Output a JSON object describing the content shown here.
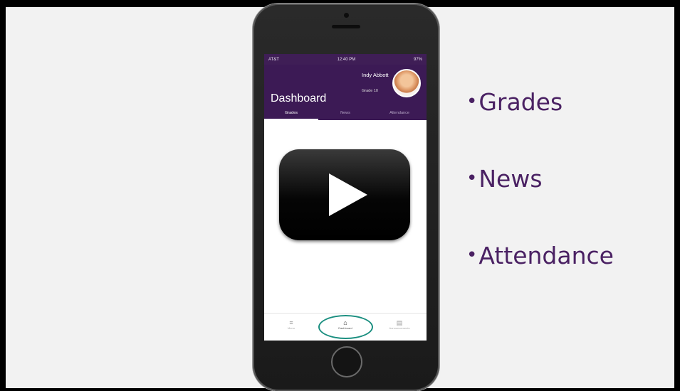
{
  "phone": {
    "status": {
      "carrier": "AT&T",
      "time": "12:40 PM",
      "battery": "97%"
    },
    "header": {
      "title": "Dashboard",
      "user_name": "Indy Abbott",
      "user_grade": "Grade 10"
    },
    "tabs": [
      {
        "label": "Grades",
        "active": true
      },
      {
        "label": "News",
        "active": false
      },
      {
        "label": "Attendance",
        "active": false
      }
    ],
    "bottom_nav": [
      {
        "label": "Menu",
        "icon": "menu-icon"
      },
      {
        "label": "Dashboard",
        "icon": "home-icon",
        "active": true
      },
      {
        "label": "Announcements",
        "icon": "calendar-icon"
      }
    ]
  },
  "bullets": [
    "Grades",
    "News",
    "Attendance"
  ],
  "colors": {
    "brand_purple": "#3c1a55",
    "bullet_text": "#4a2163",
    "highlight": "#1b8f80"
  }
}
